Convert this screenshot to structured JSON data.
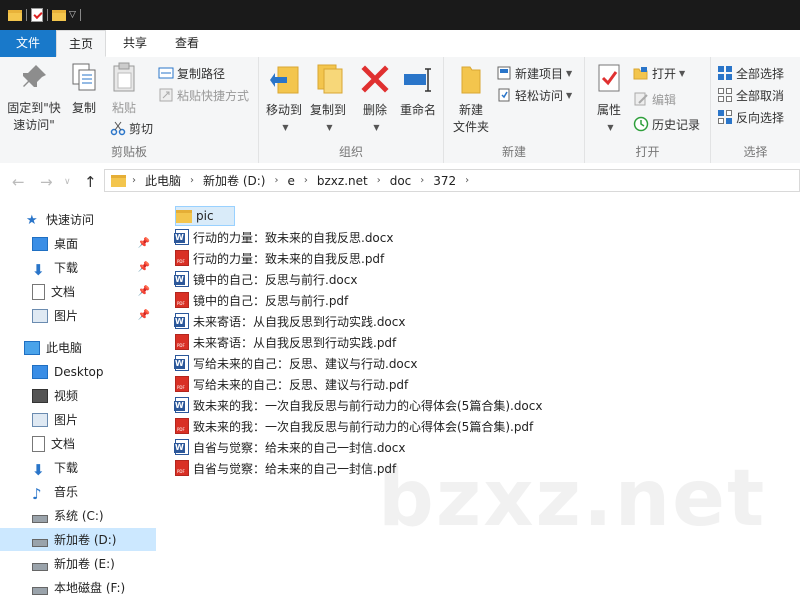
{
  "ribbon_tabs": [
    "文件",
    "主页",
    "共享",
    "查看"
  ],
  "clipboard": {
    "pin_label": "固定到\"快速访问\"",
    "copy_label": "复制",
    "paste_label": "粘贴",
    "copy_path_label": "复制路径",
    "paste_shortcut_label": "粘贴快捷方式",
    "cut_label": "剪切",
    "group_label": "剪贴板"
  },
  "organize": {
    "move_to_label": "移动到",
    "copy_to_label": "复制到",
    "delete_label": "删除",
    "rename_label": "重命名",
    "group_label": "组织"
  },
  "new_group": {
    "new_folder_label": "新建\n文件夹",
    "new_item_label": "新建项目",
    "easy_access_label": "轻松访问",
    "group_label": "新建"
  },
  "open_group": {
    "properties_label": "属性",
    "open_label": "打开",
    "edit_label": "编辑",
    "history_label": "历史记录",
    "group_label": "打开"
  },
  "select_group": {
    "select_all_label": "全部选择",
    "select_none_label": "全部取消",
    "invert_label": "反向选择",
    "group_label": "选择"
  },
  "breadcrumb": [
    "此电脑",
    "新加卷 (D:)",
    "e",
    "bzxz.net",
    "doc",
    "372"
  ],
  "nav": {
    "quick_access": "快速访问",
    "quick_items": [
      "桌面",
      "下载",
      "文档",
      "图片"
    ],
    "this_pc": "此电脑",
    "pc_items": [
      "Desktop",
      "视频",
      "图片",
      "文档",
      "下载",
      "音乐",
      "系统 (C:)",
      "新加卷 (D:)",
      "新加卷 (E:)",
      "本地磁盘 (F:)"
    ]
  },
  "files": [
    {
      "name": "pic",
      "type": "folder"
    },
    {
      "name": "行动的力量：致未来的自我反思.docx",
      "type": "docx"
    },
    {
      "name": "行动的力量：致未来的自我反思.pdf",
      "type": "pdf"
    },
    {
      "name": "镜中的自己：反思与前行.docx",
      "type": "docx"
    },
    {
      "name": "镜中的自己：反思与前行.pdf",
      "type": "pdf"
    },
    {
      "name": "未来寄语：从自我反思到行动实践.docx",
      "type": "docx"
    },
    {
      "name": "未来寄语：从自我反思到行动实践.pdf",
      "type": "pdf"
    },
    {
      "name": "写给未来的自己：反思、建议与行动.docx",
      "type": "docx"
    },
    {
      "name": "写给未来的自己：反思、建议与行动.pdf",
      "type": "pdf"
    },
    {
      "name": "致未来的我：一次自我反思与前行动力的心得体会(5篇合集).docx",
      "type": "docx"
    },
    {
      "name": "致未来的我：一次自我反思与前行动力的心得体会(5篇合集).pdf",
      "type": "pdf"
    },
    {
      "name": "自省与觉察：给未来的自己一封信.docx",
      "type": "docx"
    },
    {
      "name": "自省与觉察：给未来的自己一封信.pdf",
      "type": "pdf"
    }
  ],
  "watermark": "bzxz.net"
}
